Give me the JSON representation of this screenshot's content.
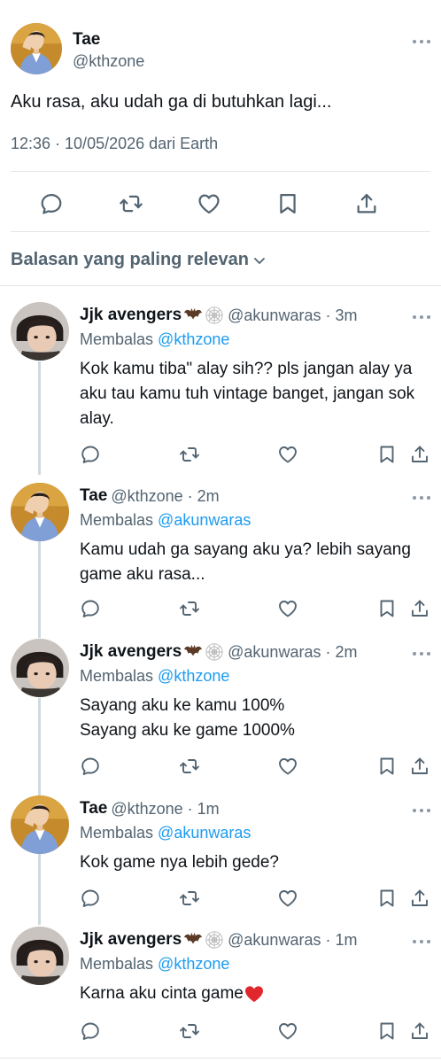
{
  "main_tweet": {
    "name": "Tae",
    "handle": "@kthzone",
    "text": "Aku rasa, aku udah ga di butuhkan lagi...",
    "meta": "12:36 · 10/05/2026 dari Earth"
  },
  "sort_label": "Balasan yang paling relevan",
  "replies": [
    {
      "name": "Jjk avengers",
      "handle": "@akunwaras · 3m",
      "replying_prefix": "Membalas",
      "replying_to": "@kthzone",
      "text": "Kok kamu tiba\" alay sih?? pls jangan alay ya aku tau kamu tuh vintage banget, jangan sok alay."
    },
    {
      "name": "Tae",
      "handle": "@kthzone · 2m",
      "replying_prefix": "Membalas",
      "replying_to": "@akunwaras",
      "text": "Kamu udah ga sayang aku ya? lebih sayang game aku rasa..."
    },
    {
      "name": "Jjk avengers",
      "handle": "@akunwaras · 2m",
      "replying_prefix": "Membalas",
      "replying_to": "@kthzone",
      "text_line1": "Sayang aku ke kamu 100%",
      "text_line2": "Sayang aku ke game 1000%"
    },
    {
      "name": "Tae",
      "handle": "@kthzone · 1m",
      "replying_prefix": "Membalas",
      "replying_to": "@akunwaras",
      "text": "Kok game nya lebih gede?"
    },
    {
      "name": "Jjk avengers",
      "handle": "@akunwaras · 1m",
      "replying_prefix": "Membalas",
      "replying_to": "@kthzone",
      "text": "Karna aku cinta game"
    }
  ],
  "icons": {
    "reply": "reply-icon",
    "retweet": "retweet-icon",
    "like": "heart-icon",
    "bookmark": "bookmark-icon",
    "share": "share-icon",
    "more": "more-icon",
    "heart_emoji": "red-heart-emoji",
    "bat_emoji": "bat-emoji",
    "web_emoji": "spider-web-emoji"
  },
  "colors": {
    "text": "#0f1419",
    "secondary": "#536471",
    "link": "#1d9bf0",
    "divider": "#e1e6ea",
    "thread_line": "#cfd9de"
  }
}
